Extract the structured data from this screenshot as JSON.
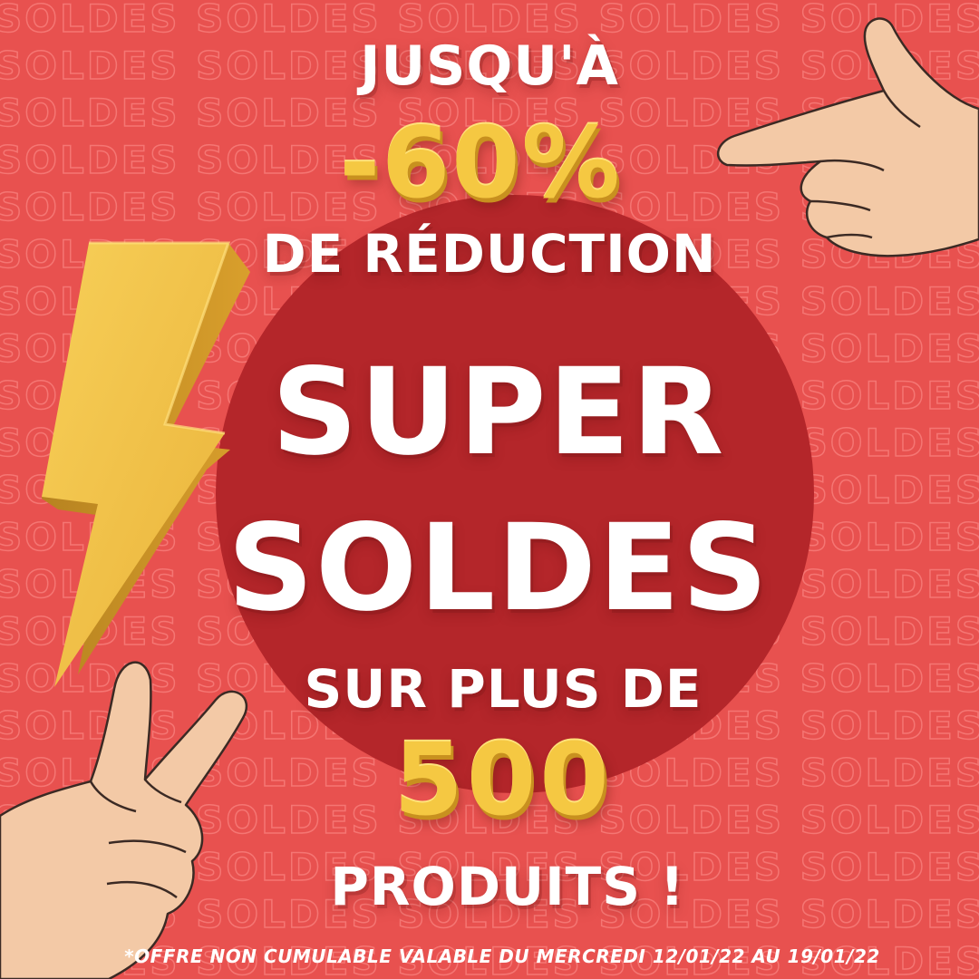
{
  "background": {
    "pattern_word": "SOLDES",
    "color": "#e8514f",
    "circle_color": "#b4262a"
  },
  "headline": {
    "line1": "JUSQU'À",
    "discount": "-60%",
    "line3": "DE RÉDUCTION"
  },
  "title": {
    "line1": "SUPER",
    "line2": "SOLDES"
  },
  "subline": {
    "line1": "SUR PLUS DE",
    "count": "500",
    "line3": "PRODUITS !"
  },
  "footnote": "*OFFRE NON CUMULABLE VALABLE DU MERCREDI 12/01/22 AU 19/01/22",
  "colors": {
    "accent_yellow": "#f5c842",
    "text_white": "#ffffff"
  },
  "icons": [
    "lightning-bolt-icon",
    "pointing-hand-icon",
    "peace-hand-icon"
  ]
}
